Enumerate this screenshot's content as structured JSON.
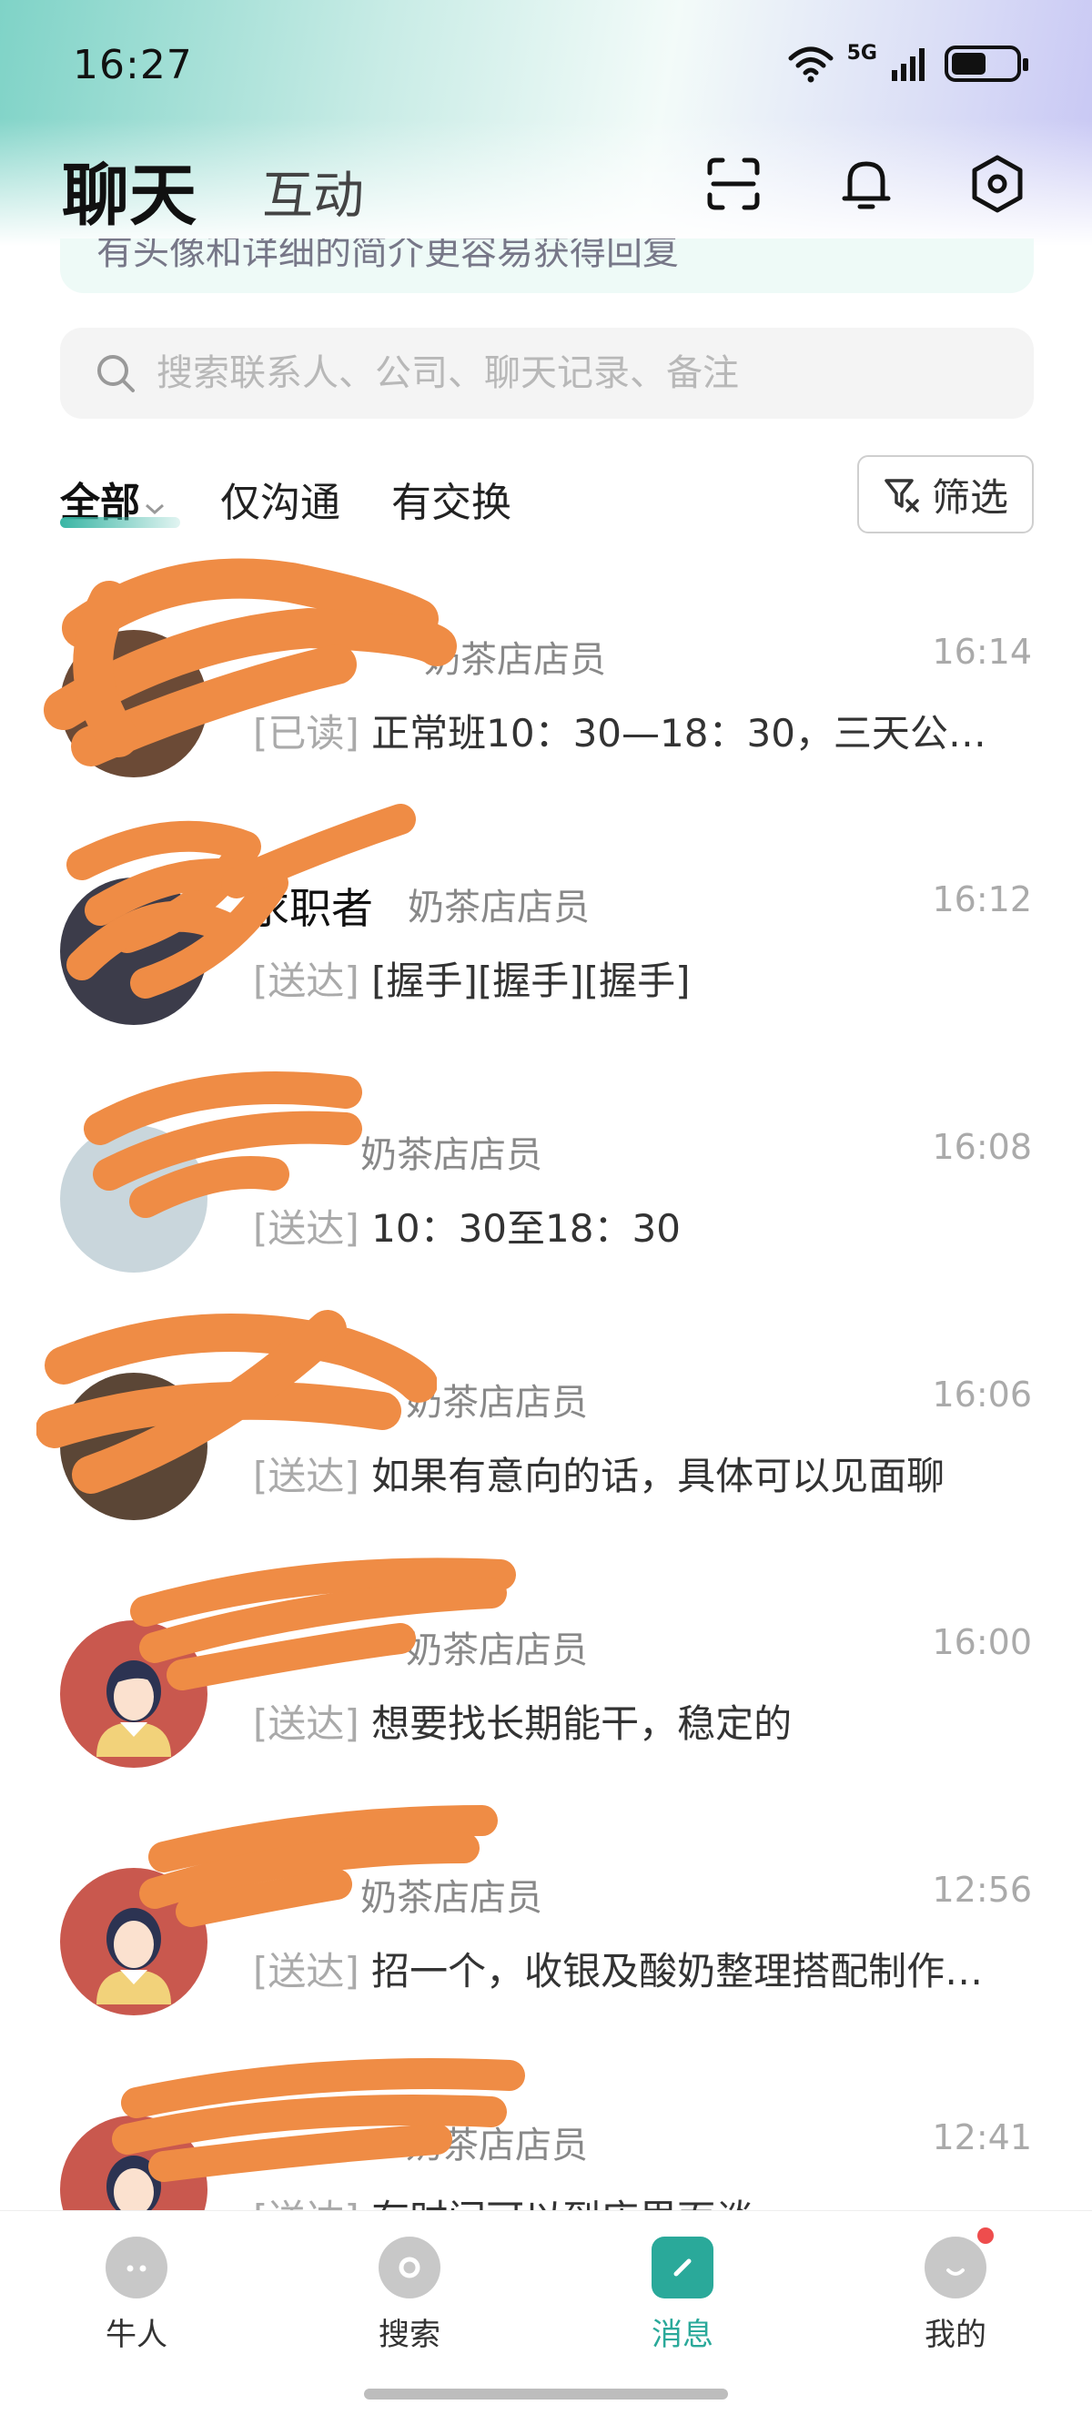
{
  "status_bar": {
    "time": "16:27",
    "network": "5G",
    "battery_level": 0.55
  },
  "header": {
    "tab_chat": "聊天",
    "tab_interact": "互动"
  },
  "banner": {
    "text": "有头像和详细的简介更容易获得回复"
  },
  "search": {
    "placeholder": "搜索联系人、公司、聊天记录、备注"
  },
  "filters": {
    "tabs": [
      {
        "label": "全部"
      },
      {
        "label": "仅沟通"
      },
      {
        "label": "有交换"
      }
    ],
    "filter_button": "筛选"
  },
  "chats": [
    {
      "name": "",
      "role": "奶茶店店员",
      "time": "16:14",
      "status": "[已读]",
      "message": "正常班10：30—18：30，三天公…"
    },
    {
      "name": "求职者",
      "role": "奶茶店店员",
      "time": "16:12",
      "status": "[送达]",
      "message": "[握手][握手][握手]"
    },
    {
      "name": "",
      "role": "奶茶店店员",
      "time": "16:08",
      "status": "[送达]",
      "message": "10：30至18：30"
    },
    {
      "name": "",
      "role": "奶茶店店员",
      "time": "16:06",
      "status": "[送达]",
      "message": "如果有意向的话，具体可以见面聊"
    },
    {
      "name": "",
      "role": "奶茶店店员",
      "time": "16:00",
      "status": "[送达]",
      "message": "想要找长期能干，稳定的"
    },
    {
      "name": "",
      "role": "奶茶店店员",
      "time": "12:56",
      "status": "[送达]",
      "message": "招一个，收银及酸奶整理搭配制作…"
    },
    {
      "name": "",
      "role": "奶茶店店员",
      "time": "12:41",
      "status": "[送达]",
      "message": "有时间可以到店里面谈"
    }
  ],
  "bottom_nav": [
    {
      "label": "牛人"
    },
    {
      "label": "搜索"
    },
    {
      "label": "消息"
    },
    {
      "label": "我的"
    }
  ],
  "colors": {
    "accent": "#2aa99a",
    "scribble": "#ef8c45",
    "badge": "#ee4d4d"
  }
}
